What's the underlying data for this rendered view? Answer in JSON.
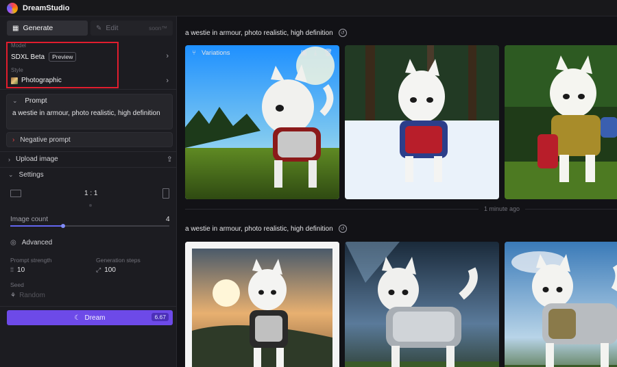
{
  "app": {
    "title": "DreamStudio"
  },
  "tabs": {
    "generate": "Generate",
    "edit": "Edit",
    "edit_badge": "soon™"
  },
  "model": {
    "label": "Model",
    "name": "SDXL Beta",
    "badge": "Preview"
  },
  "style": {
    "label": "Style",
    "name": "Photographic"
  },
  "prompt": {
    "label": "Prompt",
    "text": "a westie in armour, photo realistic, high definition"
  },
  "negative_prompt": {
    "label": "Negative prompt"
  },
  "upload": {
    "label": "Upload image"
  },
  "settings": {
    "label": "Settings",
    "aspect_ratio": "1 : 1"
  },
  "image_count": {
    "label": "Image count",
    "value": "4",
    "fraction": 0.33
  },
  "advanced": {
    "label": "Advanced"
  },
  "prompt_strength": {
    "label": "Prompt strength",
    "value": "10"
  },
  "generation_steps": {
    "label": "Generation steps",
    "value": "100"
  },
  "seed": {
    "label": "Seed",
    "placeholder": "Random"
  },
  "dream": {
    "label": "Dream",
    "cost": "6.67"
  },
  "main": {
    "groups": [
      {
        "title": "a westie in armour, photo realistic, high definition"
      },
      {
        "title": "a westie in armour, photo realistic, high definition"
      }
    ],
    "timestamp": "1 minute ago",
    "overlay": {
      "variations": "Variations"
    }
  },
  "colors": {
    "accent": "#6d4ae8",
    "highlight": "#e11d2e",
    "bg": "#121216",
    "sidebar": "#1c1c21"
  }
}
